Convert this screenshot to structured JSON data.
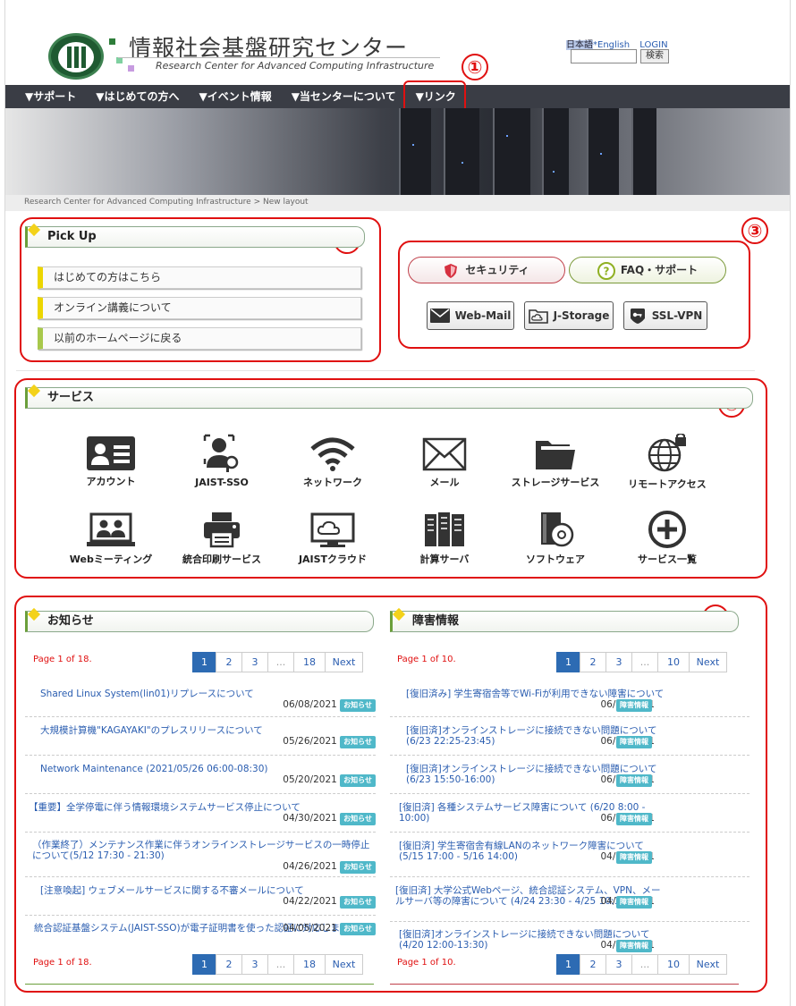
{
  "header": {
    "title": "情報社会基盤研究センター",
    "subtitle": "Research Center for Advanced Computing Infrastructure",
    "lang_ja": "日本語",
    "lang_en": "*English",
    "login": "LOGIN",
    "search_button": "検索"
  },
  "nav": [
    "▼サポート",
    "▼はじめての方へ",
    "▼イベント情報",
    "▼当センターについて",
    "▼リンク"
  ],
  "breadcrumb": {
    "home": "Research Center for Advanced Computing Infrastructure",
    "sep": ">",
    "current": "New layout"
  },
  "callouts": [
    "①",
    "②",
    "③",
    "④",
    "⑤"
  ],
  "pickup": {
    "title": "Pick Up",
    "items": [
      "はじめての方はこちら",
      "オンライン講義について",
      "以前のホームページに戻る"
    ]
  },
  "quick": {
    "security": "セキュリティ",
    "faq": "FAQ・サポート",
    "webmail": "Web-Mail",
    "jstorage": "J-Storage",
    "sslvpn": "SSL-VPN"
  },
  "services": {
    "title": "サービス",
    "items": [
      "アカウント",
      "JAIST-SSO",
      "ネットワーク",
      "メール",
      "ストレージサービス",
      "リモートアクセス",
      "Webミーティング",
      "統合印刷サービス",
      "JAISTクラウド",
      "計算サーバ",
      "ソフトウェア",
      "サービス一覧"
    ]
  },
  "news": {
    "title": "お知らせ",
    "page_label": "Page 1 of 18.",
    "pages": [
      "1",
      "2",
      "3",
      "...",
      "18",
      "Next"
    ],
    "badge": "お知らせ",
    "items": [
      {
        "title": "Shared Linux System(lin01)リプレースについて",
        "date": "06/08/2021"
      },
      {
        "title": "大規模計算機\"KAGAYAKI\"のプレスリリースについて",
        "date": "05/26/2021"
      },
      {
        "title": "Network Maintenance (2021/05/26 06:00-08:30)",
        "date": "05/20/2021"
      },
      {
        "title": "【重要】全学停電に伴う情報環境システムサービス停止について",
        "date": "04/30/2021"
      },
      {
        "title": "（作業終了）メンテナンス作業に伴うオンラインストレージサービスの一時停止について(5/12 17:30 - 21:30)",
        "date": "04/26/2021"
      },
      {
        "title": "[注意喚起] ウェブメールサービスに関する不審メールについて",
        "date": "04/22/2021"
      },
      {
        "title": "統合認証基盤システム(JAIST-SSO)が電子証明書を使った認証に対応しました",
        "date": "04/05/2021"
      }
    ]
  },
  "outage": {
    "title": "障害情報",
    "page_label": "Page 1 of 10.",
    "pages": [
      "1",
      "2",
      "3",
      "...",
      "10",
      "Next"
    ],
    "badge": "障害情報",
    "items": [
      {
        "title": "[復旧済み] 学生寄宿舎等でWi-Fiが利用できない障害について",
        "date": "06/25/2021"
      },
      {
        "title": "[復旧済]オンラインストレージに接続できない問題について(6/23 22:25-23:45)",
        "date": "06/23/2021"
      },
      {
        "title": "[復旧済]オンラインストレージに接続できない問題について(6/23 15:50-16:00)",
        "date": "06/23/2021"
      },
      {
        "title": "[復旧済] 各種システムサービス障害について (6/20 8:00 - 10:00)",
        "date": "06/21/2021"
      },
      {
        "title": "[復旧済] 学生寄宿舎有線LANのネットワーク障害について(5/15 17:00 - 5/16 14:00)",
        "date": "04/25/2021"
      },
      {
        "title": "[復旧済] 大学公式Webページ、統合認証システム、VPN、メールサーバ等の障害について (4/24 23:30 - 4/25 10:12)",
        "date": "04/25/2021"
      },
      {
        "title": "[復旧済]オンラインストレージに接続できない問題について(4/20 12:00-13:30)",
        "date": "04/20/2021"
      }
    ]
  }
}
